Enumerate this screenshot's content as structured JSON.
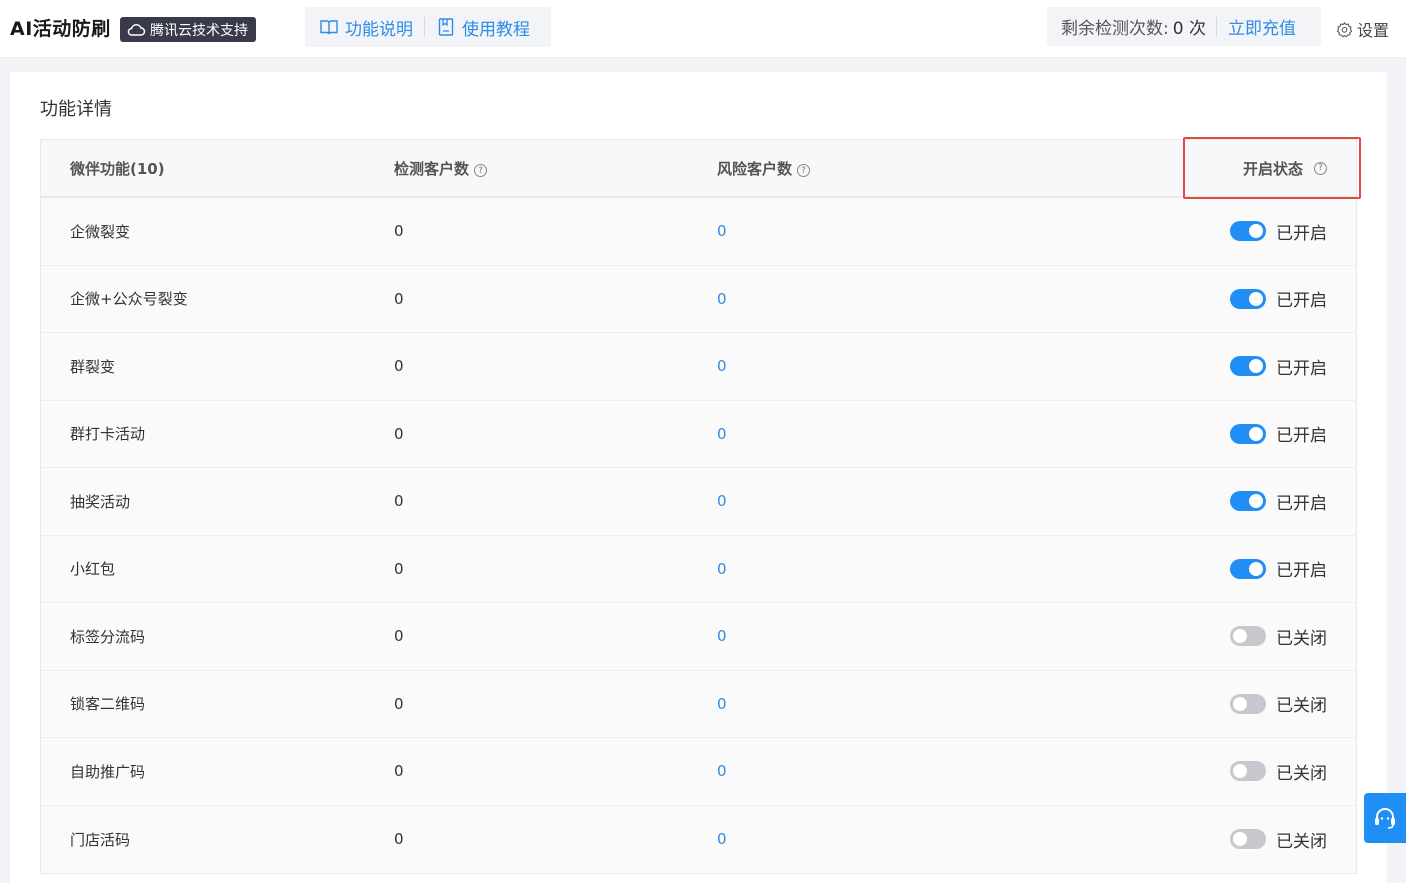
{
  "header": {
    "app_title": "AI活动防刷",
    "badge": "腾讯云技术支持",
    "help_links": [
      {
        "label": "功能说明",
        "icon": "book-icon"
      },
      {
        "label": "使用教程",
        "icon": "document-icon"
      }
    ],
    "quota_label": "剩余检测次数:",
    "quota_value": "0 次",
    "recharge_label": "立即充值",
    "settings_label": "设置"
  },
  "panel": {
    "title": "功能详情",
    "columns": {
      "name": "微伴功能(10)",
      "detect": "检测客户数",
      "risk": "风险客户数",
      "status": "开启状态"
    },
    "rows": [
      {
        "name": "企微裂变",
        "detect": "0",
        "risk": "0",
        "enabled": true,
        "status": "已开启"
      },
      {
        "name": "企微+公众号裂变",
        "detect": "0",
        "risk": "0",
        "enabled": true,
        "status": "已开启"
      },
      {
        "name": "群裂变",
        "detect": "0",
        "risk": "0",
        "enabled": true,
        "status": "已开启"
      },
      {
        "name": "群打卡活动",
        "detect": "0",
        "risk": "0",
        "enabled": true,
        "status": "已开启"
      },
      {
        "name": "抽奖活动",
        "detect": "0",
        "risk": "0",
        "enabled": true,
        "status": "已开启"
      },
      {
        "name": "小红包",
        "detect": "0",
        "risk": "0",
        "enabled": true,
        "status": "已开启"
      },
      {
        "name": "标签分流码",
        "detect": "0",
        "risk": "0",
        "enabled": false,
        "status": "已关闭"
      },
      {
        "name": "锁客二维码",
        "detect": "0",
        "risk": "0",
        "enabled": false,
        "status": "已关闭"
      },
      {
        "name": "自助推广码",
        "detect": "0",
        "risk": "0",
        "enabled": false,
        "status": "已关闭"
      },
      {
        "name": "门店活码",
        "detect": "0",
        "risk": "0",
        "enabled": false,
        "status": "已关闭"
      }
    ]
  },
  "colors": {
    "accent": "#1f8ff5",
    "link": "#2f8be8",
    "highlight_box": "#e04b3f",
    "toggle_off": "#c6c8cd"
  }
}
